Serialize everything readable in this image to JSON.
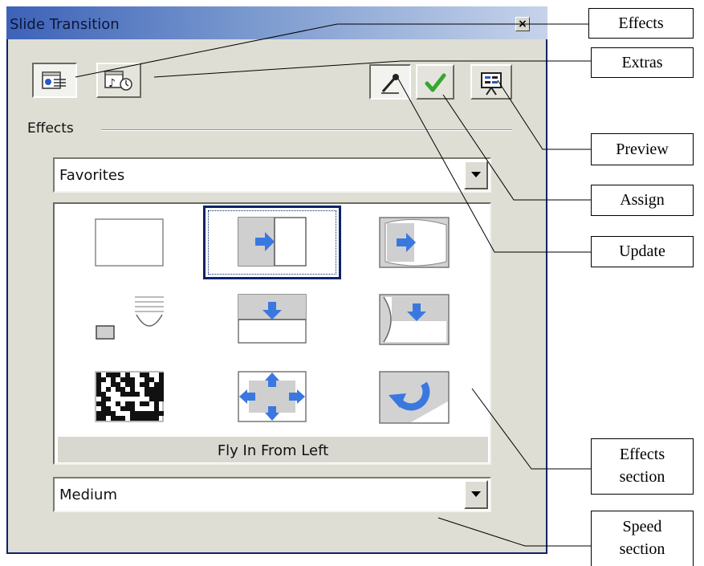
{
  "dialog": {
    "title": "Slide Transition"
  },
  "effects_section": {
    "label": "Effects",
    "category": "Favorites",
    "selected_effect": "Fly In From Left",
    "speed": "Medium"
  },
  "effects_grid": [
    {
      "name": "none-effect-icon"
    },
    {
      "name": "fly-in-from-left-icon",
      "selected": true
    },
    {
      "name": "fly-in-from-left-curved-icon"
    },
    {
      "name": "blinds-icon"
    },
    {
      "name": "fly-in-from-top-icon"
    },
    {
      "name": "fly-in-from-top-curved-icon"
    },
    {
      "name": "dissolve-icon"
    },
    {
      "name": "expand-icon"
    },
    {
      "name": "rotate-icon"
    }
  ],
  "callouts": {
    "effects": "Effects",
    "extras": "Extras",
    "preview": "Preview",
    "assign": "Assign",
    "update": "Update",
    "effects_section": [
      "Effects",
      "section"
    ],
    "speed_section": [
      "Speed",
      "section"
    ]
  },
  "colors": {
    "title_bar_start": "#3d62b8",
    "dialog_bg": "#deded4",
    "accent_blue": "#3a78e0",
    "assign_green": "#34a82e"
  }
}
